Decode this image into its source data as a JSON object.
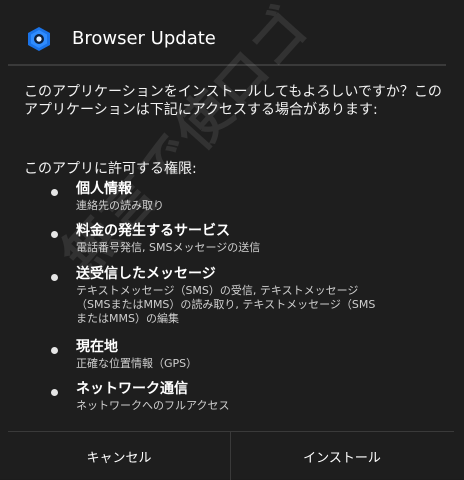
{
  "dialog": {
    "title": "Browser Update",
    "app_icon": "blue-hexagon-app-icon",
    "intro": "このアプリケーションをインストールしてもよろしいですか？このアプリケーションは下記にアクセスする場合があります:",
    "permissions_heading": "このアプリに許可する権限:",
    "permissions": [
      {
        "title": "個人情報",
        "desc": "連絡先の読み取り"
      },
      {
        "title": "料金の発生するサービス",
        "desc": "電話番号発信, SMSメッセージの送信"
      },
      {
        "title": "送受信したメッセージ",
        "desc": "テキストメッセージ（SMS）の受信, テキストメッセージ（SMSまたはMMS）の読み取り, テキストメッセージ（SMSまたはMMS）の編集"
      },
      {
        "title": "現在地",
        "desc": "正確な位置情報（GPS）"
      },
      {
        "title": "ネットワーク通信",
        "desc": "ネットワークへのフルアクセス"
      }
    ],
    "watermark": "無言で使ロゴ",
    "buttons": {
      "cancel": "キャンセル",
      "install": "インストール"
    }
  },
  "colors": {
    "background": "#1e1e1e",
    "divider": "#3a3a3a",
    "icon_blue": "#1a73e8",
    "text": "#ffffff"
  }
}
